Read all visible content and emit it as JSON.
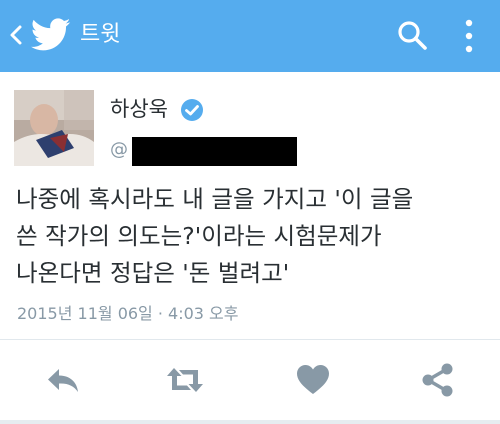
{
  "appbar": {
    "title": "트윗",
    "color": "#55acee",
    "icons": [
      "back-chevron-icon",
      "twitter-bird-icon",
      "search-icon",
      "more-vertical-icon"
    ]
  },
  "tweet": {
    "user_name": "하상욱",
    "verified": true,
    "handle_prefix": "@",
    "text_lines": [
      "나중에 혹시라도 내 글을 가지고 '이 글을",
      "쓴 작가의 의도는?'이라는 시험문제가",
      "나온다면 정답은 '돈 벌려고'"
    ],
    "timestamp": "2015년 11월 06일 · 4:03 오후"
  },
  "actions": [
    "reply-icon",
    "retweet-icon",
    "like-heart-icon",
    "share-icon"
  ],
  "colors": {
    "accent": "#55acee",
    "icon_gray": "#8899a6",
    "text": "#292f33"
  }
}
